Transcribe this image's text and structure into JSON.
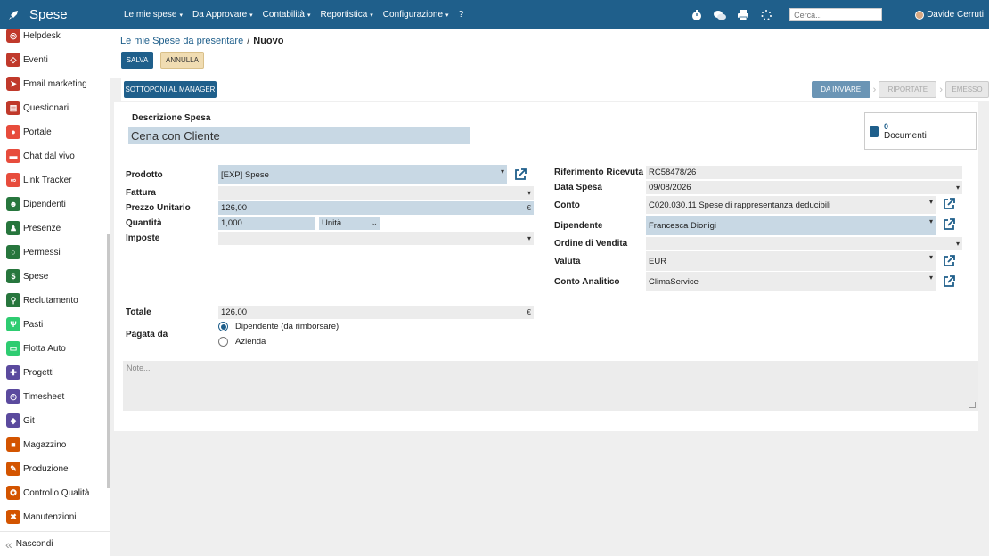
{
  "topbar": {
    "app_title": "Spese",
    "menu": [
      {
        "label": "Le mie spese",
        "caret": "▾"
      },
      {
        "label": "Da Approvare",
        "caret": "▾"
      },
      {
        "label": "Contabilità",
        "caret": "▾"
      },
      {
        "label": "Reportistica",
        "caret": "▾"
      },
      {
        "label": "Configurazione",
        "caret": "▾"
      },
      {
        "label": "?",
        "caret": ""
      }
    ],
    "search_placeholder": "Cerca...",
    "user_name": "Davide Cerruti",
    "icons": [
      "timer-icon",
      "chat-icon",
      "printer-icon",
      "loading-icon"
    ]
  },
  "sidebar": {
    "items": [
      {
        "label": "Helpdesk",
        "icon": "lifebuoy-icon",
        "color": "#c0392b"
      },
      {
        "label": "Eventi",
        "icon": "ticket-icon",
        "color": "#c0392b"
      },
      {
        "label": "Email marketing",
        "icon": "paper-plane-icon",
        "color": "#c0392b"
      },
      {
        "label": "Questionari",
        "icon": "clipboard-icon",
        "color": "#c0392b"
      },
      {
        "label": "Portale",
        "icon": "globe-icon",
        "color": "#e74c3c"
      },
      {
        "label": "Chat dal vivo",
        "icon": "chat-bubble-icon",
        "color": "#e74c3c"
      },
      {
        "label": "Link Tracker",
        "icon": "link-icon",
        "color": "#e74c3c"
      },
      {
        "label": "Dipendenti",
        "icon": "people-icon",
        "color": "#27763d"
      },
      {
        "label": "Presenze",
        "icon": "person-icon",
        "color": "#27763d"
      },
      {
        "label": "Permessi",
        "icon": "leaf-icon",
        "color": "#27763d"
      },
      {
        "label": "Spese",
        "icon": "dollar-icon",
        "color": "#27763d"
      },
      {
        "label": "Reclutamento",
        "icon": "search-person-icon",
        "color": "#27763d"
      },
      {
        "label": "Pasti",
        "icon": "cutlery-icon",
        "color": "#2ecc71"
      },
      {
        "label": "Flotta Auto",
        "icon": "car-icon",
        "color": "#2ecc71"
      },
      {
        "label": "Progetti",
        "icon": "puzzle-icon",
        "color": "#5b4a9e"
      },
      {
        "label": "Timesheet",
        "icon": "clock-icon",
        "color": "#5b4a9e"
      },
      {
        "label": "Git",
        "icon": "git-icon",
        "color": "#5b4a9e"
      },
      {
        "label": "Magazzino",
        "icon": "box-icon",
        "color": "#d35400"
      },
      {
        "label": "Produzione",
        "icon": "wrench-icon",
        "color": "#d35400"
      },
      {
        "label": "Controllo Qualità",
        "icon": "quality-icon",
        "color": "#d35400"
      },
      {
        "label": "Manutenzioni",
        "icon": "hammer-icon",
        "color": "#d35400"
      }
    ],
    "hide_label": "Nascondi"
  },
  "breadcrumb": {
    "parent": "Le mie Spese da presentare",
    "separator": "/",
    "current": "Nuovo"
  },
  "actions": {
    "save": "SALVA",
    "cancel": "ANNULLA",
    "submit": "SOTTOPONI AL MANAGER"
  },
  "status": {
    "stages": [
      "DA INVIARE",
      "RIPORTATE",
      "EMESSO"
    ],
    "active": "DA INVIARE",
    "arrow": "›"
  },
  "form": {
    "description_label": "Descrizione Spesa",
    "description_value": "Cena con Cliente",
    "documents_count": "0",
    "documents_label": "Documenti",
    "left": {
      "prodotto_label": "Prodotto",
      "prodotto_value": "[EXP] Spese",
      "fattura_label": "Fattura",
      "fattura_value": "",
      "prezzo_label": "Prezzo Unitario",
      "prezzo_value": "126,00",
      "currency": "€",
      "quantita_label": "Quantità",
      "quantita_value": "1,000",
      "unita_value": "Unità",
      "imposte_label": "Imposte",
      "imposte_value": "",
      "totale_label": "Totale",
      "totale_value": "126,00",
      "pagata_label": "Pagata da",
      "pagata_options": [
        "Dipendente (da rimborsare)",
        "Azienda"
      ],
      "pagata_selected": "Dipendente (da rimborsare)"
    },
    "right": {
      "rif_label": "Riferimento Ricevuta",
      "rif_value": "RC58478/26",
      "data_label": "Data Spesa",
      "data_value": "09/08/2026",
      "conto_label": "Conto",
      "conto_value": "C020.030.11 Spese di rappresentanza deducibili",
      "dipendente_label": "Dipendente",
      "dipendente_value": "Francesca Dionigi",
      "ordine_label": "Ordine di Vendita",
      "ordine_value": "",
      "valuta_label": "Valuta",
      "valuta_value": "EUR",
      "analitico_label": "Conto Analitico",
      "analitico_value": "ClimaService"
    },
    "notes_placeholder": "Note..."
  }
}
